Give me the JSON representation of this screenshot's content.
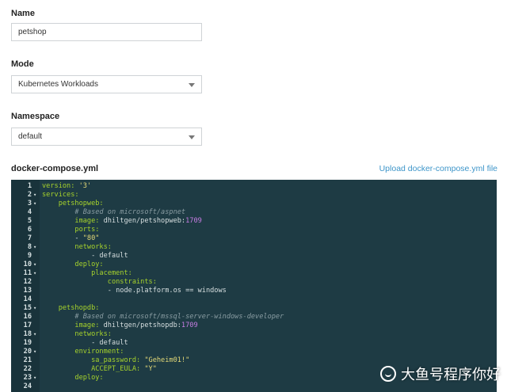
{
  "form": {
    "name_label": "Name",
    "name_value": "petshop",
    "mode_label": "Mode",
    "mode_value": "Kubernetes Workloads",
    "namespace_label": "Namespace",
    "namespace_value": "default",
    "compose_label": "docker-compose.yml",
    "upload_label": "Upload docker-compose.yml file"
  },
  "editor": {
    "lines": [
      {
        "n": "1",
        "fold": "",
        "code": [
          {
            "t": "version: ",
            "c": "k"
          },
          {
            "t": "'3'",
            "c": "s"
          }
        ]
      },
      {
        "n": "2",
        "fold": "▾",
        "code": [
          {
            "t": "services:",
            "c": "k"
          }
        ]
      },
      {
        "n": "3",
        "fold": "▾",
        "code": [
          {
            "t": "    petshopweb:",
            "c": "k"
          }
        ]
      },
      {
        "n": "4",
        "fold": "",
        "code": [
          {
            "t": "        # Based on microsoft/aspnet",
            "c": "c"
          }
        ]
      },
      {
        "n": "5",
        "fold": "",
        "code": [
          {
            "t": "        image: ",
            "c": "k"
          },
          {
            "t": "dhiltgen/petshopweb:",
            "c": "t"
          },
          {
            "t": "1709",
            "c": "n"
          }
        ]
      },
      {
        "n": "6",
        "fold": "",
        "code": [
          {
            "t": "        ports:",
            "c": "k"
          }
        ]
      },
      {
        "n": "7",
        "fold": "",
        "code": [
          {
            "t": "        - ",
            "c": "t"
          },
          {
            "t": "\"80\"",
            "c": "s"
          }
        ]
      },
      {
        "n": "8",
        "fold": "▾",
        "code": [
          {
            "t": "        networks:",
            "c": "k"
          }
        ]
      },
      {
        "n": "9",
        "fold": "",
        "code": [
          {
            "t": "            - default",
            "c": "t"
          }
        ]
      },
      {
        "n": "10",
        "fold": "▾",
        "code": [
          {
            "t": "        deploy:",
            "c": "k"
          }
        ]
      },
      {
        "n": "11",
        "fold": "▾",
        "code": [
          {
            "t": "            placement:",
            "c": "k"
          }
        ]
      },
      {
        "n": "12",
        "fold": "",
        "code": [
          {
            "t": "                constraints:",
            "c": "k"
          }
        ]
      },
      {
        "n": "13",
        "fold": "",
        "code": [
          {
            "t": "                - node.platform.os == windows",
            "c": "t"
          }
        ]
      },
      {
        "n": "14",
        "fold": "",
        "code": [
          {
            "t": "",
            "c": "t"
          }
        ]
      },
      {
        "n": "15",
        "fold": "▾",
        "code": [
          {
            "t": "    petshopdb:",
            "c": "k"
          }
        ]
      },
      {
        "n": "16",
        "fold": "",
        "code": [
          {
            "t": "        # Based on microsoft/mssql-server-windows-developer",
            "c": "c"
          }
        ]
      },
      {
        "n": "17",
        "fold": "",
        "code": [
          {
            "t": "        image: ",
            "c": "k"
          },
          {
            "t": "dhiltgen/petshopdb:",
            "c": "t"
          },
          {
            "t": "1709",
            "c": "n"
          }
        ]
      },
      {
        "n": "18",
        "fold": "▾",
        "code": [
          {
            "t": "        networks:",
            "c": "k"
          }
        ]
      },
      {
        "n": "19",
        "fold": "",
        "code": [
          {
            "t": "            - default",
            "c": "t"
          }
        ]
      },
      {
        "n": "20",
        "fold": "▾",
        "code": [
          {
            "t": "        environment:",
            "c": "k"
          }
        ]
      },
      {
        "n": "21",
        "fold": "",
        "code": [
          {
            "t": "            sa_password: ",
            "c": "k"
          },
          {
            "t": "\"Geheim01!\"",
            "c": "s"
          }
        ]
      },
      {
        "n": "22",
        "fold": "",
        "code": [
          {
            "t": "            ACCEPT_EULA: ",
            "c": "k"
          },
          {
            "t": "\"Y\"",
            "c": "s"
          }
        ]
      },
      {
        "n": "23",
        "fold": "▾",
        "code": [
          {
            "t": "        deploy:",
            "c": "k"
          }
        ]
      },
      {
        "n": "24",
        "fold": "",
        "code": [
          {
            "t": "",
            "c": "t"
          }
        ]
      }
    ]
  },
  "watermark": {
    "text": "大鱼号程序你好",
    "icon": "wechat-icon"
  }
}
